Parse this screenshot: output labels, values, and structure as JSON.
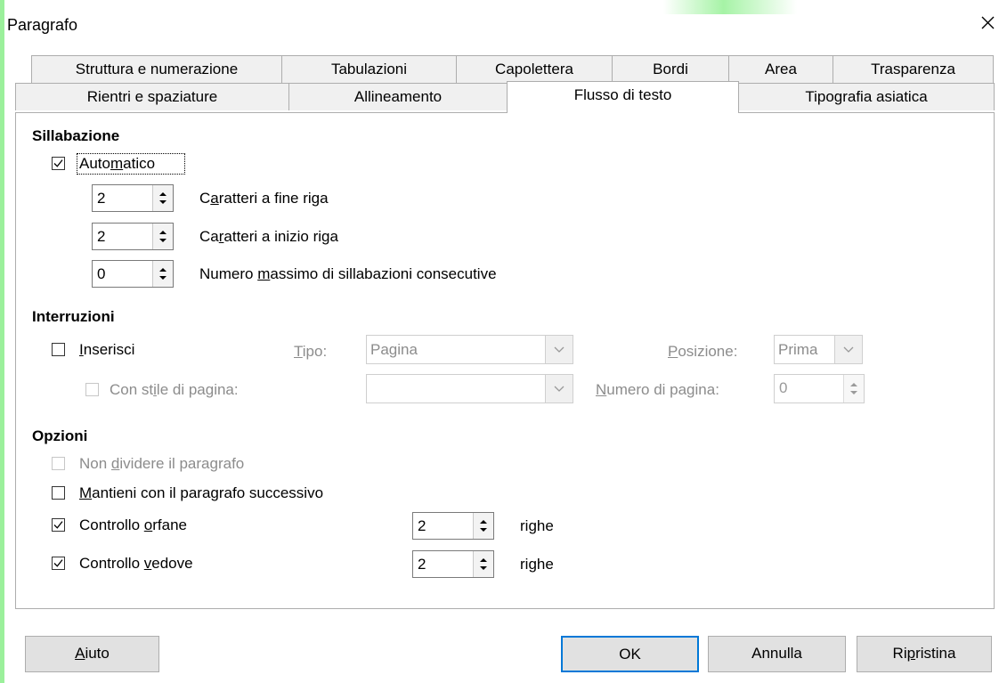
{
  "dialog": {
    "title": "Paragrafo",
    "close_symbol": "×"
  },
  "tabs_row1": [
    "Struttura e numerazione",
    "Tabulazioni",
    "Capolettera",
    "Bordi",
    "Area",
    "Trasparenza"
  ],
  "tabs_row2": [
    "Rientri e spaziature",
    "Allineamento",
    "Flusso di testo",
    "Tipografia asiatica"
  ],
  "active_tab": "Flusso di testo",
  "hyphenation": {
    "heading": "Sillabazione",
    "automatic": {
      "label_pre": "Auto",
      "label_u": "m",
      "label_post": "atico",
      "checked": true
    },
    "end_chars": {
      "value": "2",
      "label_pre": "C",
      "label_u": "a",
      "label_post": "ratteri a fine riga"
    },
    "start_chars": {
      "value": "2",
      "label_pre": "Ca",
      "label_u": "r",
      "label_post": "atteri a inizio riga"
    },
    "max_hyphens": {
      "value": "0",
      "label_pre": "Numero ",
      "label_u": "m",
      "label_post": "assimo di sillabazioni consecutive"
    }
  },
  "breaks": {
    "heading": "Interruzioni",
    "insert": {
      "label_pre": "",
      "label_u": "I",
      "label_post": "nserisci",
      "checked": false
    },
    "type": {
      "label_pre": "",
      "label_u": "T",
      "label_post": "ipo:",
      "value": "Pagina"
    },
    "position": {
      "label_pre": "",
      "label_u": "P",
      "label_post": "osizione:",
      "value": "Prima"
    },
    "page_style": {
      "label_pre": "Con st",
      "label_u": "i",
      "label_post": "le di pagina:",
      "checked": false,
      "value": ""
    },
    "page_number": {
      "label_pre": "",
      "label_u": "N",
      "label_post": "umero di pagina:",
      "value": "0"
    }
  },
  "options": {
    "heading": "Opzioni",
    "dont_split": {
      "label_pre": "Non ",
      "label_u": "d",
      "label_post": "ividere il paragrafo",
      "checked": false
    },
    "keep_next": {
      "label_pre": "",
      "label_u": "M",
      "label_post": "antieni con il paragrafo successivo",
      "checked": false
    },
    "orphan": {
      "label_pre": "Controllo ",
      "label_u": "o",
      "label_post": "rfane",
      "checked": true,
      "value": "2",
      "unit": "righe"
    },
    "widow": {
      "label_pre": "Controllo ",
      "label_u": "v",
      "label_post": "edove",
      "checked": true,
      "value": "2",
      "unit": "righe"
    }
  },
  "buttons": {
    "help": {
      "label_pre": "",
      "label_u": "A",
      "label_post": "iuto"
    },
    "ok": {
      "label": "OK"
    },
    "cancel": {
      "label": "Annulla"
    },
    "reset": {
      "label_pre": "Ri",
      "label_u": "p",
      "label_post": "ristina"
    }
  },
  "colors": {
    "accent": "#0078d7",
    "highlight": "#9bf09b"
  }
}
